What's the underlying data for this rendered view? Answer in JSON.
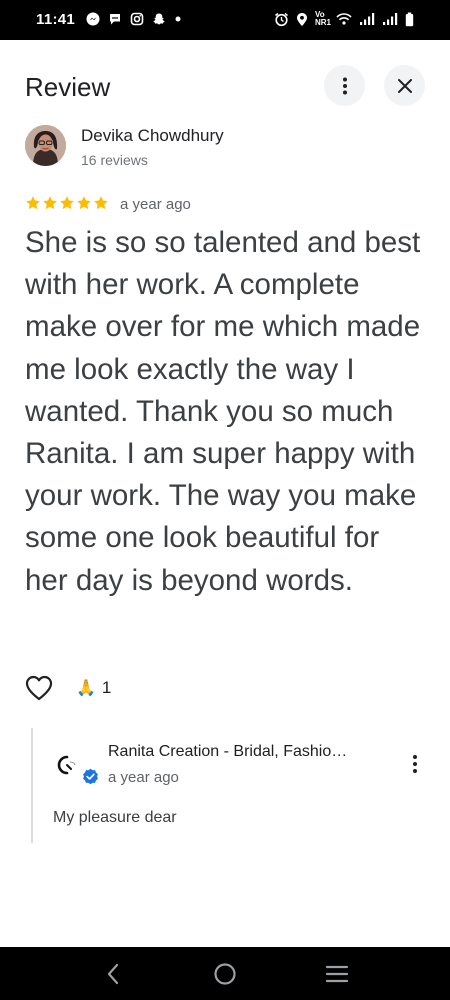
{
  "status_bar": {
    "time": "11:41",
    "network_label": "Vo NR1"
  },
  "header": {
    "title": "Review"
  },
  "reviewer": {
    "name": "Devika Chowdhury",
    "review_count": "16 reviews"
  },
  "review": {
    "rating": 5,
    "max_rating": 5,
    "star_color": "#fbbc04",
    "date": "a year ago",
    "text": "She is so so talented and best with her work. A complete make over for me which made me look exactly the way I wanted. Thank you so much Ranita. I am super happy with your work. The way you make some one look beautiful for her day is beyond words."
  },
  "reactions": {
    "emoji": "🙏",
    "count": "1"
  },
  "owner_reply": {
    "name": "Ranita Creation - Bridal, Fashio…",
    "date": "a year ago",
    "text": "My pleasure dear",
    "verified_color": "#1a73e8"
  },
  "icons": {
    "more": "more-vert-icon",
    "close": "close-icon",
    "like": "heart-outline-icon",
    "back": "back-icon",
    "home": "home-icon",
    "recents": "recents-icon"
  }
}
